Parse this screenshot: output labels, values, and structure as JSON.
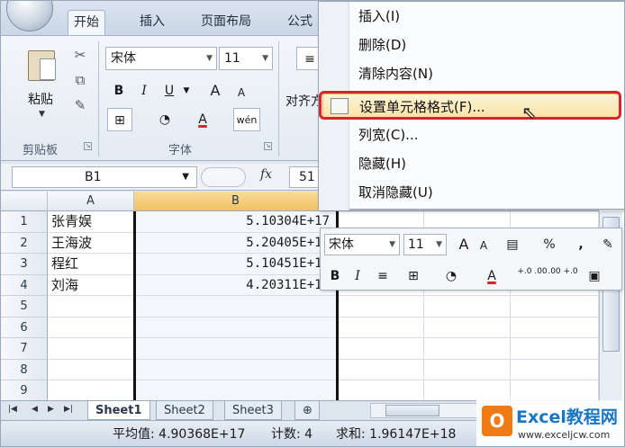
{
  "ribbon": {
    "tabs": [
      {
        "label": "开始",
        "active": true
      },
      {
        "label": "插入"
      },
      {
        "label": "页面布局"
      },
      {
        "label": "公式"
      }
    ],
    "clipboard": {
      "paste_label": "粘贴",
      "group_label": "剪贴板"
    },
    "font": {
      "name": "宋体",
      "size": "11",
      "group_label": "字体",
      "bold": "B",
      "italic": "I",
      "underline": "U",
      "grow": "A",
      "shrink": "A",
      "font_color_glyph": "A",
      "phonetic_glyph": "wén"
    },
    "alignment": {
      "group_label_partial": "对齐方"
    }
  },
  "formula_bar": {
    "name_box": "B1",
    "fx": "fx",
    "value": "51"
  },
  "columns": [
    "A",
    "B"
  ],
  "selected_column": "B",
  "rows": [
    {
      "num": "1",
      "a": "张青娱",
      "b": "5.10304E+17"
    },
    {
      "num": "2",
      "a": "王海波",
      "b": "5.20405E+17"
    },
    {
      "num": "3",
      "a": "程红",
      "b": "5.10451E+17"
    },
    {
      "num": "4",
      "a": "刘海",
      "b": "4.20311E+17"
    },
    {
      "num": "5",
      "a": "",
      "b": ""
    },
    {
      "num": "6",
      "a": "",
      "b": ""
    },
    {
      "num": "7",
      "a": "",
      "b": ""
    },
    {
      "num": "8",
      "a": "",
      "b": ""
    },
    {
      "num": "9",
      "a": "",
      "b": ""
    }
  ],
  "context_menu": {
    "items": [
      {
        "label": "插入(I)"
      },
      {
        "label": "删除(D)"
      },
      {
        "label": "清除内容(N)"
      },
      {
        "label": "设置单元格格式(F)...",
        "highlighted": true
      },
      {
        "label": "列宽(C)..."
      },
      {
        "label": "隐藏(H)"
      },
      {
        "label": "取消隐藏(U)"
      }
    ]
  },
  "mini_toolbar": {
    "font": "宋体",
    "size": "11",
    "percent": "%",
    "comma": ",",
    "bold": "B",
    "italic": "I",
    "font_color_glyph": "A",
    "inc_decimal": "+.0 .00",
    "dec_decimal": ".00 +.0"
  },
  "sheets": [
    {
      "label": "Sheet1",
      "active": true
    },
    {
      "label": "Sheet2"
    },
    {
      "label": "Sheet3"
    }
  ],
  "status": {
    "average": "平均值: 4.90368E+17",
    "count": "计数: 4",
    "sum": "求和: 1.96147E+18"
  },
  "watermark": {
    "title": "Excel教程网",
    "url": "www.exceljcw.com",
    "logo_glyph": "O"
  },
  "colors": {
    "accent_highlight": "#d6262c",
    "watermark_orange": "#f07a14",
    "watermark_blue": "#1976c2"
  }
}
